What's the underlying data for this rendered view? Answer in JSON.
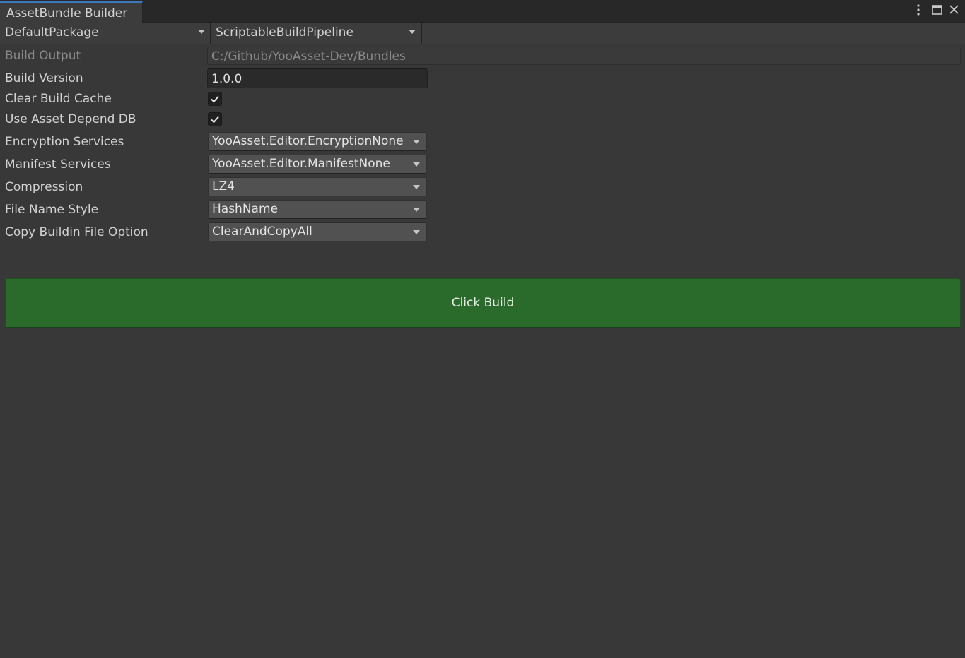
{
  "window": {
    "title": "AssetBundle Builder",
    "icons": [
      "kebab-menu-icon",
      "maximize-icon",
      "close-icon"
    ]
  },
  "toolbar": {
    "package": "DefaultPackage",
    "pipeline": "ScriptableBuildPipeline"
  },
  "form": {
    "build_output": {
      "label": "Build Output",
      "value": "C:/Github/YooAsset-Dev/Bundles"
    },
    "build_version": {
      "label": "Build Version",
      "value": "1.0.0"
    },
    "clear_build_cache": {
      "label": "Clear Build Cache",
      "checked": true
    },
    "use_asset_depend_db": {
      "label": "Use Asset Depend DB",
      "checked": true
    },
    "encryption_services": {
      "label": "Encryption Services",
      "value": "YooAsset.Editor.EncryptionNone"
    },
    "manifest_services": {
      "label": "Manifest Services",
      "value": "YooAsset.Editor.ManifestNone"
    },
    "compression": {
      "label": "Compression",
      "value": "LZ4"
    },
    "file_name_style": {
      "label": "File Name Style",
      "value": "HashName"
    },
    "copy_buildin_file_option": {
      "label": "Copy Buildin File Option",
      "value": "ClearAndCopyAll"
    }
  },
  "build_button": {
    "label": "Click Build"
  },
  "colors": {
    "background": "#383838",
    "tab_accent": "#3a79bb",
    "build_button": "#2a6b2b"
  }
}
